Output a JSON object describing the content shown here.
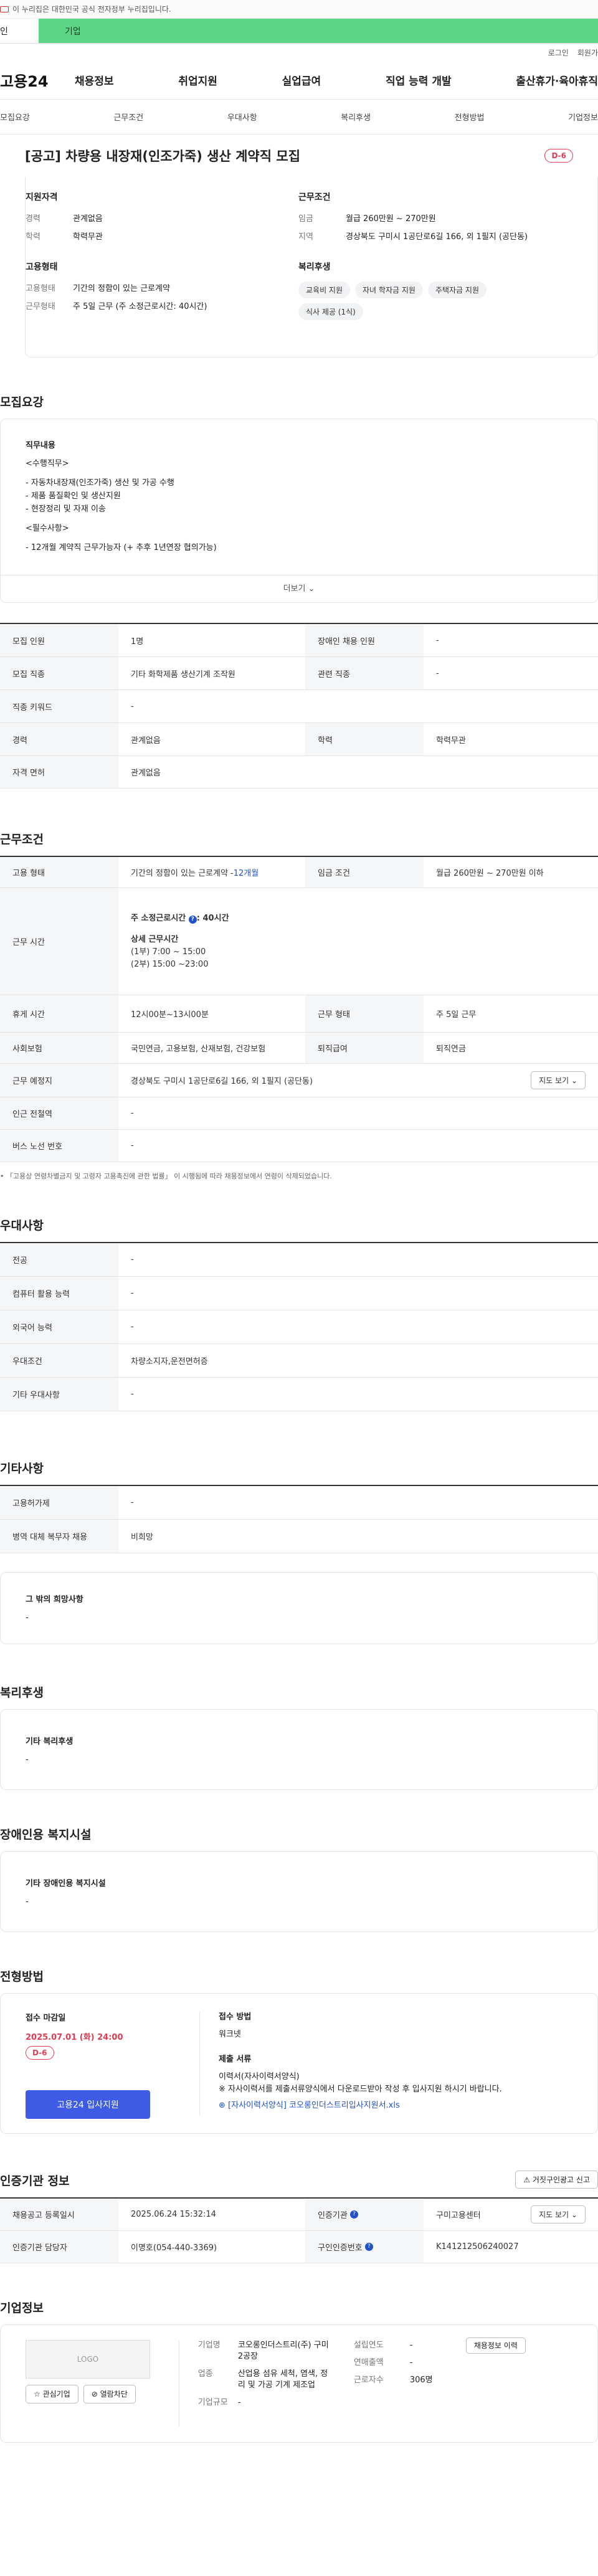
{
  "gov_notice": "이 누리집은 대한민국 공식 전자정부 누리집입니다.",
  "tabs": [
    "인",
    "기업"
  ],
  "util": [
    "로그인",
    "회원가"
  ],
  "logo": "고용24",
  "gnb": [
    "채용정보",
    "취업지원",
    "실업급여",
    "직업 능력 개발",
    "출산휴가·육아휴직"
  ],
  "anchors": [
    "모집요강",
    "근무조건",
    "우대사항",
    "복리후생",
    "전형방법",
    "기업정보"
  ],
  "title": "[공고] 차량용 내장재(인조가죽) 생산 계약직 모집",
  "dday": "D-6",
  "summary": {
    "qual_title": "지원자격",
    "qual": [
      {
        "k": "경력",
        "v": "관계없음"
      },
      {
        "k": "학력",
        "v": "학력무관"
      }
    ],
    "emp_title": "고용형태",
    "emp": [
      {
        "k": "고용형태",
        "v": "기간의 정함이 있는 근로계약"
      },
      {
        "k": "근무형태",
        "v": "주 5일 근무 (주 소정근로시간: 40시간)"
      }
    ],
    "cond_title": "근무조건",
    "cond": [
      {
        "k": "임금",
        "v": "월급 260만원 ~ 270만원"
      },
      {
        "k": "지역",
        "v": "경상북도 구미시 1공단로6길 166, 외 1필지 (공단동)"
      }
    ],
    "welfare_title": "복리후생",
    "welfare": [
      "교육비 지원",
      "자녀 학자금 지원",
      "주택자금 지원",
      "식사 제공 (1식)"
    ]
  },
  "sections": {
    "recruit": "모집요강",
    "conditions": "근무조건",
    "preference": "우대사항",
    "etc": "기타사항",
    "welfare": "복리후생",
    "disabled": "장애인용 복지시설",
    "process": "전형방법",
    "agency": "인증기관 정보",
    "company": "기업정보"
  },
  "job_desc": {
    "title": "직무내용",
    "lines": [
      "<수행직무>",
      "- 자동차내장재(인조가죽) 생산 및 가공 수행",
      "- 제품 품질확인 및 생산지원",
      "- 현장정리 및 자재 이송",
      "<필수사항>",
      "- 12개월 계약직 근무가능자 (+ 추후 1년연장 협의가능)"
    ],
    "more": "더보기"
  },
  "recruit_table": [
    {
      "k": "모집 인원",
      "v": "1명",
      "k2": "장애인 채용 인원",
      "v2": "-"
    },
    {
      "k": "모집 직종",
      "v": "기타 화학제품 생산기계 조작원",
      "k2": "관련 직종",
      "v2": "-"
    },
    {
      "k": "직종 키워드",
      "v": "-"
    },
    {
      "k": "경력",
      "v": "관계없음",
      "k2": "학력",
      "v2": "학력무관"
    },
    {
      "k": "자격 면허",
      "v": "관계없음"
    }
  ],
  "cond_table": {
    "emp_k": "고용 형태",
    "emp_v": "기간의 정함이 있는 근로계약 - ",
    "emp_link": "12개월",
    "pay_k": "임금 조건",
    "pay_v": "월급 260만원 ~ 270만원 이하",
    "time_k": "근무 시간",
    "time_v": "주 소정근로시간",
    "time_n": "40시간",
    "detail_t": "상세 근무시간",
    "detail": [
      "(1부) 7:00 ~ 15:00",
      "(2부) 15:00 ~23:00"
    ],
    "rest_k": "휴게 시간",
    "rest_v": "12시00분~13시00분",
    "form_k": "근무 형태",
    "form_v": "주 5일 근무",
    "ins_k": "사회보험",
    "ins_v": "국민연금, 고용보험, 산재보험, 건강보험",
    "ret_k": "퇴직급여",
    "ret_v": "퇴직연금",
    "place_k": "근무 예정지",
    "place_v": "경상북도 구미시 1공단로6길 166, 외 1필지 (공단동)",
    "map": "지도 보기",
    "sub_k": "인근 전철역",
    "sub_v": "-",
    "bus_k": "버스 노선 번호",
    "bus_v": "-",
    "note": "「고용상 연령차별금지 및 고령자 고용촉진에 관한 법률」 이 시행됨에 따라 채용정보에서 연령이 삭제되었습니다."
  },
  "pref_table": [
    {
      "k": "전공",
      "v": "-"
    },
    {
      "k": "컴퓨터 활용 능력",
      "v": "-"
    },
    {
      "k": "외국어 능력",
      "v": "-"
    },
    {
      "k": "우대조건",
      "v": "차량소지자,운전면허증"
    },
    {
      "k": "기타 우대사항",
      "v": "-"
    }
  ],
  "etc_table": [
    {
      "k": "고용허가제",
      "v": "-"
    },
    {
      "k": "병역 대체 복무자 채용",
      "v": "비희망"
    }
  ],
  "etc_box": {
    "t": "그 밖의 희망사항",
    "v": "-"
  },
  "welfare_box": {
    "t": "기타 복리후생",
    "v": "-"
  },
  "disabled_box": {
    "t": "기타 장애인용 복지시설",
    "v": "-"
  },
  "process": {
    "deadline_t": "접수 마감일",
    "deadline": "2025.07.01 (화) 24:00",
    "dday": "D-6",
    "apply": "고용24 입사지원",
    "method_t": "접수 방법",
    "method": "워크넷",
    "docs_t": "제출 서류",
    "docs": [
      "이력서(자사이력서양식)",
      "※ 자사이력서를 제출서류양식에서 다운로드받아 작성 후 입사지원 하시기 바랍니다."
    ],
    "file": "[자사이력서양식] 코오롱인더스트리입사지원서.xls"
  },
  "agency": {
    "report": "거짓구인광고 신고",
    "reg_k": "채용공고 등록일시",
    "reg_v": "2025.06.24 15:32:14",
    "org_k": "인증기관",
    "org_v": "구미고용센터",
    "map": "지도 보기",
    "mgr_k": "인증기관 담당자",
    "mgr_v": "이명호(054-440-3369)",
    "no_k": "구인인증번호",
    "no_v": "K141212506240027"
  },
  "company": {
    "logo": "LOGO",
    "fav": "관심기업",
    "block": "열람차단",
    "name_k": "기업명",
    "name_v": "코오롱인더스트리(주) 구미2공장",
    "biz_k": "업종",
    "biz_v": "산업용 섬유 세척, 염색, 정리 및 가공 기계 제조업",
    "ceo_k": "기업규모",
    "ceo_v": "-",
    "year_k": "설립연도",
    "year_v": "-",
    "sales_k": "연매출액",
    "sales_v": "-",
    "emp_k": "근로자수",
    "emp_v": "306명",
    "jobs": "채용정보 이력"
  }
}
